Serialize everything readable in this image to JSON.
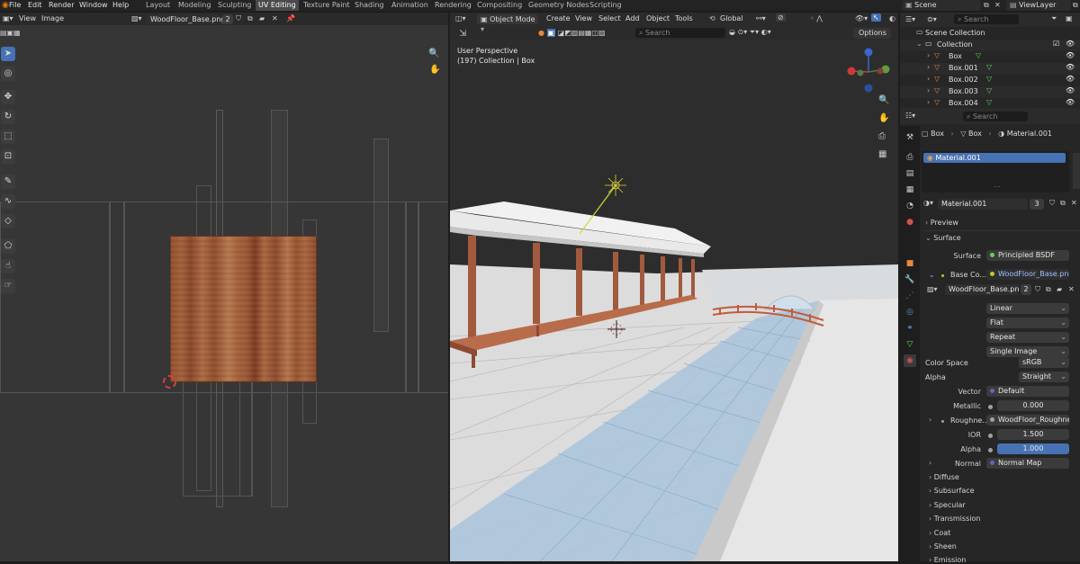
{
  "menu": [
    "File",
    "Edit",
    "Render",
    "Window",
    "Help"
  ],
  "workspaces": [
    "Layout",
    "Modeling",
    "Sculpting",
    "UV Editing",
    "Texture Paint",
    "Shading",
    "Animation",
    "Rendering",
    "Compositing",
    "Geometry Nodes",
    "Scripting"
  ],
  "active_workspace": "UV Editing",
  "scene_name": "Scene",
  "view_layer": "ViewLayer",
  "image_editor": {
    "menus": [
      "View",
      "Image"
    ],
    "image_name": "WoodFloor_Base.png",
    "users": "2"
  },
  "viewport": {
    "mode": "Object Mode",
    "menus": [
      "Create",
      "View",
      "Select",
      "Add",
      "Object",
      "Tools"
    ],
    "orientation": "Global",
    "search_placeholder": "Search",
    "options_label": "Options",
    "perspective_label": "User Perspective",
    "collection_label": "(197) Collection | Box",
    "gizmo_axes": [
      "X",
      "Y",
      "Z"
    ]
  },
  "outliner": {
    "search_placeholder": "Search",
    "scene_collection": "Scene Collection",
    "collection": "Collection",
    "objects": [
      "Box",
      "Box.001",
      "Box.002",
      "Box.003",
      "Box.004"
    ]
  },
  "properties": {
    "search_placeholder": "Search",
    "breadcrumb": [
      "Box",
      "Box",
      "Material.001"
    ],
    "material_slot": "Material.001",
    "material_name": "Material.001",
    "material_users": "3",
    "panels": {
      "preview": "Preview",
      "surface": "Surface"
    },
    "surface_label": "Surface",
    "surface_value": "Principled BSDF",
    "base_color_label": "Base Co...",
    "base_color_value": "WoodFloor_Base.png",
    "image_node_name": "WoodFloor_Base.png",
    "image_node_users": "2",
    "interpolation": "Linear",
    "projection": "Flat",
    "extension": "Repeat",
    "source": "Single Image",
    "color_space_label": "Color Space",
    "color_space": "sRGB",
    "alpha_label": "Alpha",
    "alpha_mode": "Straight",
    "vector_label": "Vector",
    "vector_value": "Default",
    "metallic_label": "Metallic",
    "metallic_value": "0.000",
    "roughness_label": "Roughne...",
    "roughness_value": "WoodFloor_Roughne...",
    "ior_label": "IOR",
    "ior_value": "1.500",
    "alpha2_label": "Alpha",
    "alpha2_value": "1.000",
    "normal_label": "Normal",
    "normal_value": "Normal Map",
    "subpanels": [
      "Diffuse",
      "Subsurface",
      "Specular",
      "Transmission",
      "Coat",
      "Sheen",
      "Emission"
    ]
  },
  "colors": {
    "accent": "#4772b3",
    "object_orange": "#e5883c",
    "mesh_green": "#5fd35f",
    "socket_yellow": "#c7c729",
    "socket_blue": "#6363c7"
  }
}
